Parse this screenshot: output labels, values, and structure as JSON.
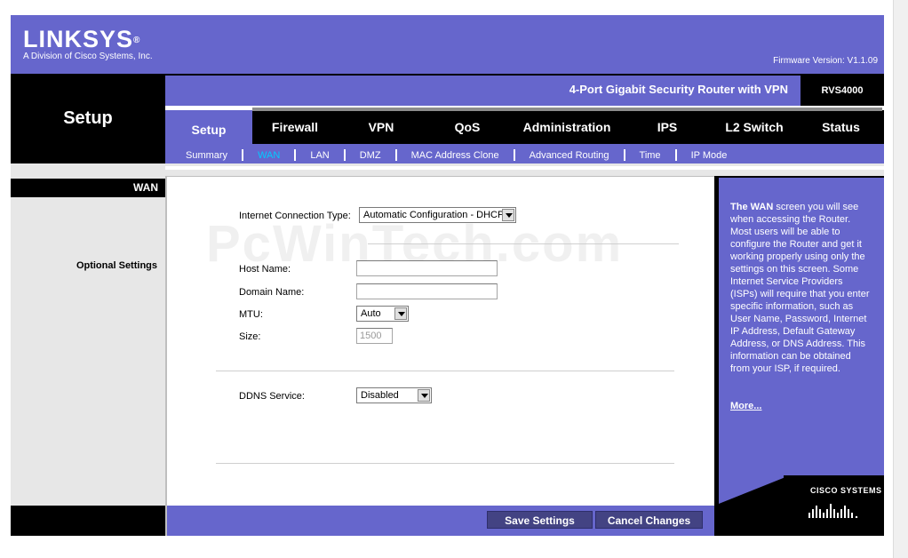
{
  "header": {
    "brand": "LINKSYS",
    "registered": "®",
    "subtitle": "A Division of Cisco Systems, Inc.",
    "firmware": "Firmware Version: V1.1.09"
  },
  "section_title": "Setup",
  "product": {
    "name": "4-Port Gigabit Security Router with VPN",
    "model": "RVS4000"
  },
  "tabs": [
    {
      "label": "Setup",
      "active": true
    },
    {
      "label": "Firewall"
    },
    {
      "label": "VPN"
    },
    {
      "label": "QoS"
    },
    {
      "label": "Administration"
    },
    {
      "label": "IPS"
    },
    {
      "label": "L2 Switch"
    },
    {
      "label": "Status"
    }
  ],
  "subtabs": [
    {
      "label": "Summary"
    },
    {
      "label": "WAN",
      "active": true
    },
    {
      "label": "LAN"
    },
    {
      "label": "DMZ"
    },
    {
      "label": "MAC Address Clone"
    },
    {
      "label": "Advanced Routing"
    },
    {
      "label": "Time"
    },
    {
      "label": "IP Mode"
    }
  ],
  "left": {
    "heading": "WAN",
    "optional_settings": "Optional Settings"
  },
  "form": {
    "connection_type_label": "Internet Connection Type:",
    "connection_type_value": "Automatic Configuration - DHCP",
    "host_name_label": "Host Name:",
    "host_name_value": "",
    "domain_name_label": "Domain Name:",
    "domain_name_value": "",
    "mtu_label": "MTU:",
    "mtu_value": "Auto",
    "size_label": "Size:",
    "size_value": "1500",
    "ddns_label": "DDNS Service:",
    "ddns_value": "Disabled"
  },
  "watermark": "PcWinTech.com",
  "help": {
    "bold_lead": "The WAN",
    "text": " screen you will see when accessing the Router. Most users will be able to configure the Router and get it working properly using only the settings on this screen. Some Internet Service Providers (ISPs) will require that you enter specific information, such as User Name, Password, Internet IP Address, Default Gateway Address, or DNS Address. This information can be obtained from your ISP, if required.",
    "more": "More..."
  },
  "cisco": {
    "text": "CISCO SYSTEMS"
  },
  "buttons": {
    "save": "Save Settings",
    "cancel": "Cancel Changes"
  }
}
